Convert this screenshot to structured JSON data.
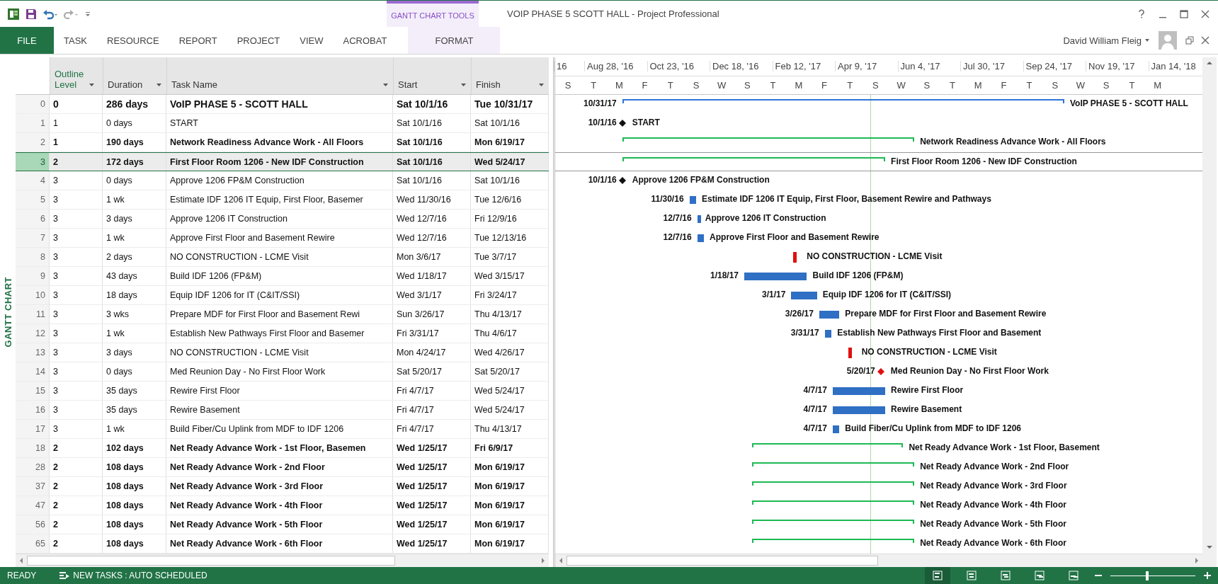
{
  "window": {
    "title": "VOIP PHASE 5 SCOTT HALL - Project Professional",
    "context_group": "GANTT CHART TOOLS",
    "user": "David William Fleig"
  },
  "ribbon_tabs": [
    {
      "label": "FILE",
      "kind": "file",
      "selected": true
    },
    {
      "label": "TASK",
      "kind": "tab",
      "selected": false
    },
    {
      "label": "RESOURCE",
      "kind": "tab",
      "selected": false
    },
    {
      "label": "REPORT",
      "kind": "tab",
      "selected": false
    },
    {
      "label": "PROJECT",
      "kind": "tab",
      "selected": false
    },
    {
      "label": "VIEW",
      "kind": "tab",
      "selected": false
    },
    {
      "label": "ACROBAT",
      "kind": "tab",
      "selected": false
    },
    {
      "label": "FORMAT",
      "kind": "contextual",
      "selected": false
    }
  ],
  "view_label": "GANTT CHART",
  "table": {
    "columns": [
      {
        "label": "Outline Level",
        "selected": true
      },
      {
        "label": "Duration",
        "selected": false
      },
      {
        "label": "Task Name",
        "selected": false
      },
      {
        "label": "Start",
        "selected": false
      },
      {
        "label": "Finish",
        "selected": false
      }
    ],
    "rows": [
      {
        "id": "0",
        "outline": "0",
        "duration": "286 days",
        "name": "VoIP PHASE 5 - SCOTT HALL",
        "start": "Sat 10/1/16",
        "finish": "Tue 10/31/17",
        "kind": "project_summary",
        "selected": false
      },
      {
        "id": "1",
        "outline": "1",
        "duration": "0 days",
        "name": "START",
        "start": "Sat 10/1/16",
        "finish": "Sat 10/1/16",
        "kind": "milestone",
        "selected": false
      },
      {
        "id": "2",
        "outline": "1",
        "duration": "190 days",
        "name": "Network Readiness Advance Work - All Floors",
        "start": "Sat 10/1/16",
        "finish": "Mon 6/19/17",
        "kind": "summary",
        "selected": false
      },
      {
        "id": "3",
        "outline": "2",
        "duration": "172 days",
        "name": "First Floor Room 1206 - New IDF Construction",
        "start": "Sat 10/1/16",
        "finish": "Wed 5/24/17",
        "kind": "summary",
        "selected": true
      },
      {
        "id": "4",
        "outline": "3",
        "duration": "0 days",
        "name": "Approve 1206 FP&M Construction",
        "start": "Sat 10/1/16",
        "finish": "Sat 10/1/16",
        "kind": "milestone",
        "selected": false
      },
      {
        "id": "5",
        "outline": "3",
        "duration": "1 wk",
        "name": "Estimate IDF 1206 IT Equip,  First Floor, Basemer",
        "start": "Wed 11/30/16",
        "finish": "Tue 12/6/16",
        "kind": "task",
        "selected": false
      },
      {
        "id": "6",
        "outline": "3",
        "duration": "3 days",
        "name": "Approve 1206 IT Construction",
        "start": "Wed 12/7/16",
        "finish": "Fri 12/9/16",
        "kind": "task",
        "selected": false
      },
      {
        "id": "7",
        "outline": "3",
        "duration": "1 wk",
        "name": "Approve First Floor and Basement Rewire",
        "start": "Wed 12/7/16",
        "finish": "Tue 12/13/16",
        "kind": "task",
        "selected": false
      },
      {
        "id": "8",
        "outline": "3",
        "duration": "2 days",
        "name": "NO CONSTRUCTION - LCME Visit",
        "start": "Mon 3/6/17",
        "finish": "Tue 3/7/17",
        "kind": "flag",
        "selected": false
      },
      {
        "id": "9",
        "outline": "3",
        "duration": "43 days",
        "name": "Build IDF 1206 (FP&M)",
        "start": "Wed 1/18/17",
        "finish": "Wed 3/15/17",
        "kind": "task",
        "selected": false
      },
      {
        "id": "10",
        "outline": "3",
        "duration": "18 days",
        "name": "Equip IDF 1206 for IT (C&IT/SSI)",
        "start": "Wed 3/1/17",
        "finish": "Fri 3/24/17",
        "kind": "task",
        "selected": false
      },
      {
        "id": "11",
        "outline": "3",
        "duration": "3 wks",
        "name": "Prepare MDF for First Floor and Basement Rewi",
        "start": "Sun 3/26/17",
        "finish": "Thu 4/13/17",
        "kind": "task",
        "selected": false
      },
      {
        "id": "12",
        "outline": "3",
        "duration": "1 wk",
        "name": "Establish New Pathways First Floor and Basemer",
        "start": "Fri 3/31/17",
        "finish": "Thu 4/6/17",
        "kind": "task",
        "selected": false
      },
      {
        "id": "13",
        "outline": "3",
        "duration": "3 days",
        "name": "NO CONSTRUCTION - LCME Visit",
        "start": "Mon 4/24/17",
        "finish": "Wed 4/26/17",
        "kind": "flag",
        "selected": false
      },
      {
        "id": "14",
        "outline": "3",
        "duration": "0 days",
        "name": "Med Reunion Day - No First Floor Work",
        "start": "Sat 5/20/17",
        "finish": "Sat 5/20/17",
        "kind": "event",
        "selected": false
      },
      {
        "id": "15",
        "outline": "3",
        "duration": "35 days",
        "name": "Rewire First Floor",
        "start": "Fri 4/7/17",
        "finish": "Wed 5/24/17",
        "kind": "task",
        "selected": false
      },
      {
        "id": "16",
        "outline": "3",
        "duration": "35 days",
        "name": "Rewire Basement",
        "start": "Fri 4/7/17",
        "finish": "Wed 5/24/17",
        "kind": "task",
        "selected": false
      },
      {
        "id": "17",
        "outline": "3",
        "duration": "1 wk",
        "name": "Build Fiber/Cu Uplink from MDF to IDF 1206",
        "start": "Fri 4/7/17",
        "finish": "Thu 4/13/17",
        "kind": "task",
        "selected": false
      },
      {
        "id": "18",
        "outline": "2",
        "duration": "102 days",
        "name": "Net Ready Advance Work - 1st Floor, Basemen",
        "start": "Wed 1/25/17",
        "finish": "Fri 6/9/17",
        "kind": "summary",
        "selected": false
      },
      {
        "id": "28",
        "outline": "2",
        "duration": "108 days",
        "name": "Net Ready Advance Work - 2nd Floor",
        "start": "Wed 1/25/17",
        "finish": "Mon 6/19/17",
        "kind": "summary",
        "selected": false
      },
      {
        "id": "37",
        "outline": "2",
        "duration": "108 days",
        "name": "Net Ready Advance Work - 3rd Floor",
        "start": "Wed 1/25/17",
        "finish": "Mon 6/19/17",
        "kind": "summary",
        "selected": false
      },
      {
        "id": "47",
        "outline": "2",
        "duration": "108 days",
        "name": "Net Ready Advance Work - 4th Floor",
        "start": "Wed 1/25/17",
        "finish": "Mon 6/19/17",
        "kind": "summary",
        "selected": false
      },
      {
        "id": "56",
        "outline": "2",
        "duration": "108 days",
        "name": "Net Ready Advance Work - 5th Floor",
        "start": "Wed 1/25/17",
        "finish": "Mon 6/19/17",
        "kind": "summary",
        "selected": false
      },
      {
        "id": "65",
        "outline": "2",
        "duration": "108 days",
        "name": "Net Ready Advance Work - 6th Floor",
        "start": "Wed 1/25/17",
        "finish": "Mon 6/19/17",
        "kind": "summary",
        "selected": false
      }
    ]
  },
  "timescale": {
    "major": [
      "16",
      "Aug 28, '16",
      "Oct 23, '16",
      "Dec 18, '16",
      "Feb 12, '17",
      "Apr 9, '17",
      "Jun 4, '17",
      "Jul 30, '17",
      "Sep 24, '17",
      "Nov 19, '17",
      "Jan 14, '18"
    ],
    "minor": [
      "S",
      "T",
      "M",
      "F",
      "T",
      "S",
      "W",
      "S",
      "T",
      "M",
      "F",
      "T",
      "S",
      "W",
      "S",
      "T",
      "M",
      "F",
      "T",
      "S",
      "W",
      "S",
      "T",
      "M"
    ]
  },
  "gantt": {
    "labels": [
      {
        "date": "10/31/17",
        "task": "VoIP PHASE 5 - SCOTT HALL"
      },
      {
        "date": "10/1/16",
        "task": "START"
      },
      {
        "task": "Network Readiness Advance Work - All Floors"
      },
      {
        "task": "First Floor Room 1206 - New IDF Construction"
      },
      {
        "date": "10/1/16",
        "task": "Approve 1206 FP&M Construction"
      },
      {
        "date": "11/30/16",
        "task": "Estimate IDF 1206 IT Equip,  First Floor, Basement Rewire and Pathways"
      },
      {
        "date": "12/7/16",
        "task": "Approve 1206 IT Construction"
      },
      {
        "date": "12/7/16",
        "task": "Approve First Floor and Basement Rewire"
      },
      {
        "task": "NO CONSTRUCTION - LCME Visit"
      },
      {
        "date": "1/18/17",
        "task": "Build IDF 1206 (FP&M)"
      },
      {
        "date": "3/1/17",
        "task": "Equip IDF 1206 for IT (C&IT/SSI)"
      },
      {
        "date": "3/26/17",
        "task": "Prepare MDF for First Floor and Basement Rewire"
      },
      {
        "date": "3/31/17",
        "task": "Establish New Pathways First Floor and Basement"
      },
      {
        "task": "NO CONSTRUCTION - LCME Visit"
      },
      {
        "date": "5/20/17",
        "task": "Med Reunion Day - No First Floor Work"
      },
      {
        "date": "4/7/17",
        "task": "Rewire First Floor"
      },
      {
        "date": "4/7/17",
        "task": "Rewire Basement"
      },
      {
        "date": "4/7/17",
        "task": "Build Fiber/Cu Uplink from MDF to IDF 1206"
      },
      {
        "task": "Net Ready Advance Work - 1st Floor, Basement"
      },
      {
        "task": "Net Ready Advance Work - 2nd Floor"
      },
      {
        "task": "Net Ready Advance Work - 3rd Floor"
      },
      {
        "task": "Net Ready Advance Work - 4th Floor"
      },
      {
        "task": "Net Ready Advance Work - 5th Floor"
      },
      {
        "task": "Net Ready Advance Work - 6th Floor"
      }
    ]
  },
  "status_bar": {
    "mode": "READY",
    "new_tasks": "NEW TASKS : AUTO SCHEDULED",
    "views": [
      {
        "selected": true
      },
      {
        "selected": false
      },
      {
        "selected": false
      },
      {
        "selected": false
      },
      {
        "selected": false
      }
    ],
    "zoom": {
      "level": 0.42
    }
  }
}
